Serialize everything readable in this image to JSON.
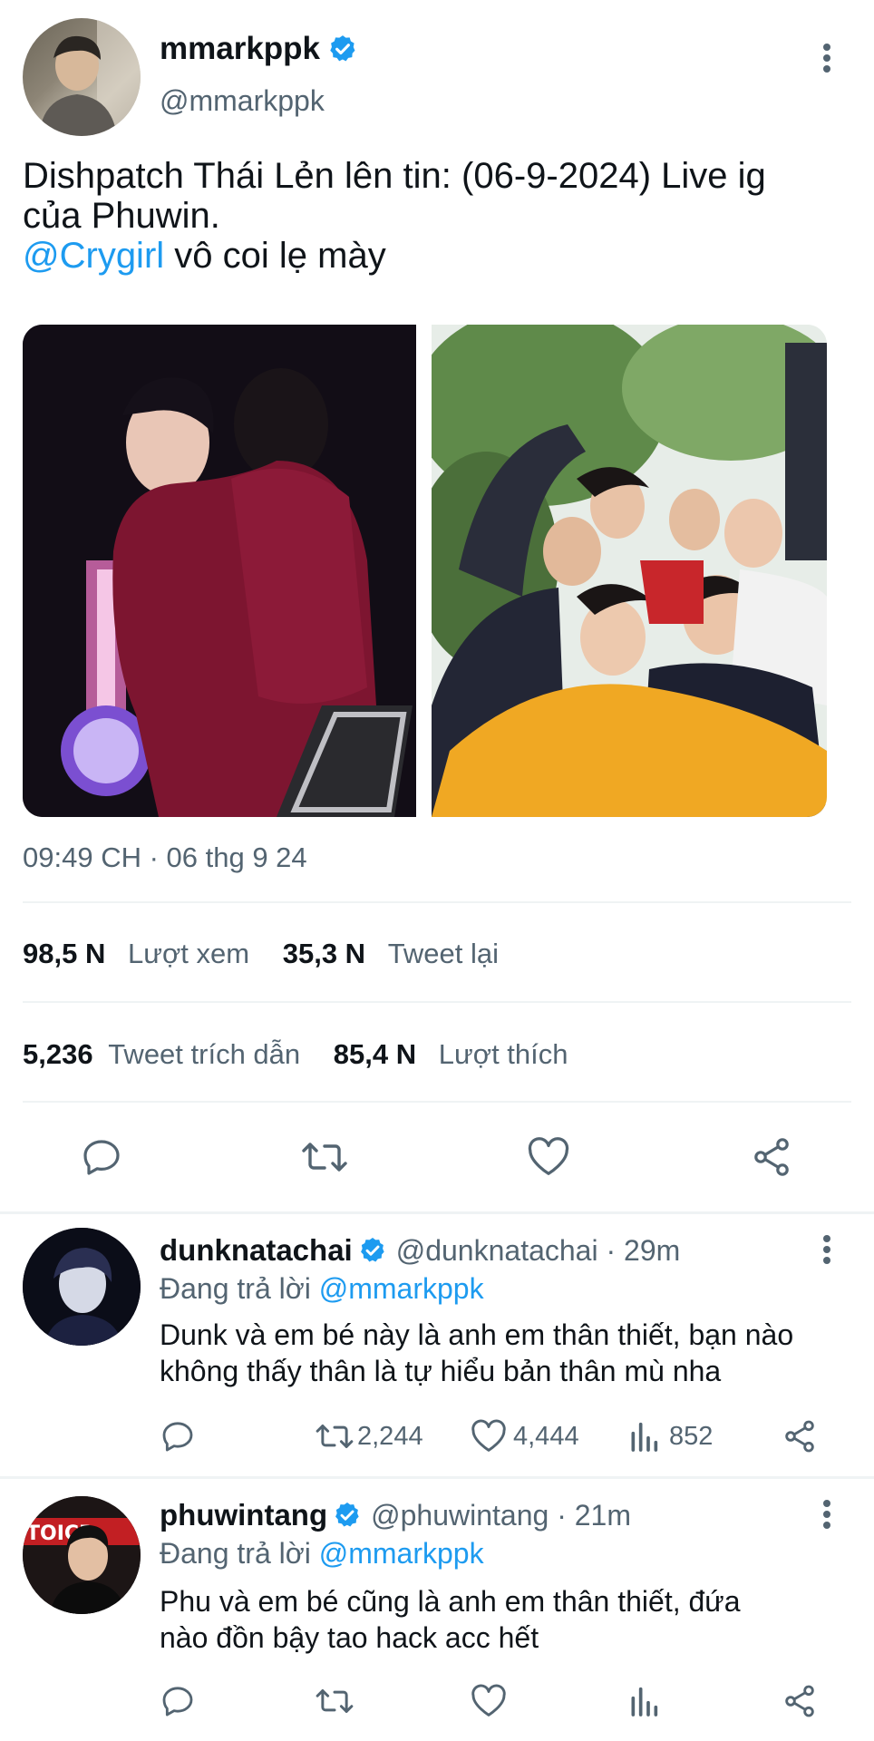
{
  "tweet": {
    "display_name": "mmarkppk",
    "handle": "@mmarkppk",
    "text_line1": "Dishpatch Thái Lẻn lên tin: (06-9-2024) Live ig",
    "text_line2": "của Phuwin.",
    "mention": "@Crygirl",
    "text_line3_rest": " vô coi lẹ mày",
    "timestamp": "09:49 CH · 06 thg 9 24",
    "stats": {
      "views_count": "98,5 N",
      "views_label": "Lượt xem",
      "retweets_count": "35,3 N",
      "retweets_label": "Tweet lại",
      "quotes_count": "5,236",
      "quotes_label": "Tweet trích dẫn",
      "likes_count": "85,4 N",
      "likes_label": "Lượt thích"
    }
  },
  "replies": [
    {
      "display_name": "dunknatachai",
      "handle_time": "@dunknatachai · 29m",
      "replying_prefix": "Đang trả lời",
      "replying_to": "@mmarkppk",
      "text_line1": "Dunk và em bé này là anh em thân thiết, bạn nào",
      "text_line2": "không thấy thân là tự hiểu bản thân mù nha",
      "retweets": "2,244",
      "likes": "4,444",
      "views": "852"
    },
    {
      "display_name": "phuwintang",
      "handle_time": "@phuwintang · 21m",
      "replying_prefix": "Đang trả lời",
      "replying_to": "@mmarkppk",
      "text_line1": "Phu và em bé cũng là anh em thân thiết, đứa",
      "text_line2": "nào đồn bậy tao hack acc hết",
      "avatar_banner_text": "TOICR"
    }
  ],
  "colors": {
    "accent": "#1d9bf0",
    "text": "#0f1419",
    "muted": "#536471",
    "divider": "#eff3f4"
  },
  "icons": [
    "more-vert-icon",
    "verified-badge-icon",
    "reply-icon",
    "retweet-icon",
    "like-icon",
    "share-icon",
    "views-icon"
  ]
}
